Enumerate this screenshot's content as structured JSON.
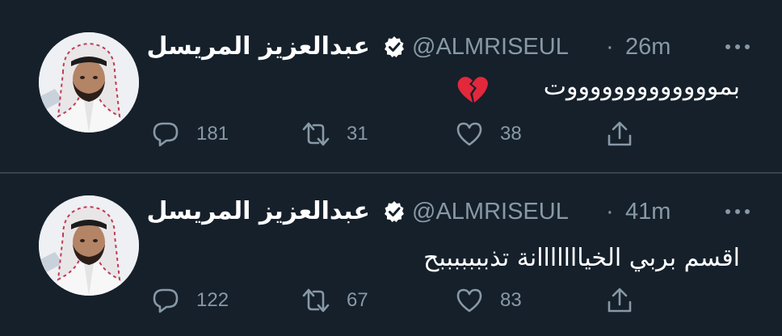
{
  "tweets": [
    {
      "author": {
        "name": "عبدالعزيز المريسل",
        "handle": "@ALMRISEUL",
        "verified": true
      },
      "separator": "·",
      "time": "26m",
      "text": "بموووووووووووووت",
      "emoji": "broken-heart",
      "stats": {
        "replies": "181",
        "retweets": "31",
        "likes": "38"
      }
    },
    {
      "author": {
        "name": "عبدالعزيز المريسل",
        "handle": "@ALMRISEUL",
        "verified": true
      },
      "separator": "·",
      "time": "41m",
      "text": "اقسم بربي الخيااااااانة تذبببببببح",
      "stats": {
        "replies": "122",
        "retweets": "67",
        "likes": "83"
      }
    }
  ],
  "colors": {
    "background": "#15202b",
    "divider": "#38444d",
    "secondary_text": "#8899a6",
    "primary_text": "#ffffff",
    "broken_heart": "#e3283b"
  }
}
